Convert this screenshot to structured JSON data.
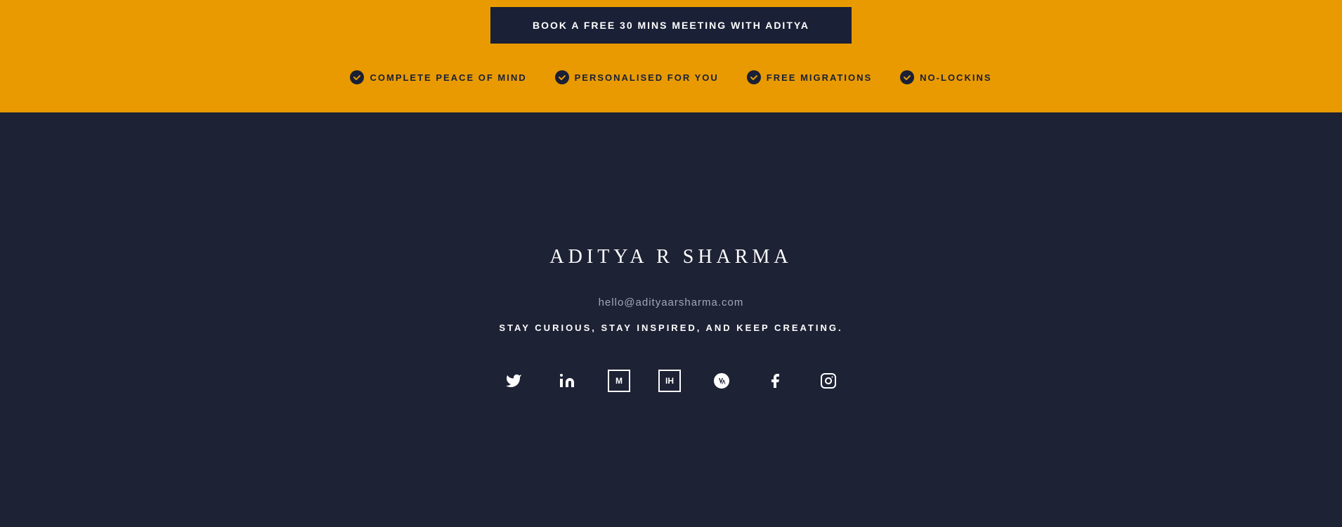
{
  "orange_section": {
    "cta_button_label": "BOOK A FREE 30 MINS MEETING WITH ADITYA",
    "features": [
      {
        "id": "peace",
        "text": "COMPLETE PEACE OF MIND"
      },
      {
        "id": "personalised",
        "text": "PERSONALISED FOR YOU"
      },
      {
        "id": "migrations",
        "text": "FREE MIGRATIONS"
      },
      {
        "id": "lockins",
        "text": "NO-LOCKINS"
      }
    ]
  },
  "dark_section": {
    "name": "ADITYA R SHARMA",
    "email": "hello@adityaarsharma.com",
    "tagline": "STAY CURIOUS, STAY INSPIRED, AND KEEP CREATING.",
    "social_links": [
      {
        "id": "twitter",
        "label": "Twitter"
      },
      {
        "id": "linkedin",
        "label": "LinkedIn"
      },
      {
        "id": "medium",
        "label": "Medium"
      },
      {
        "id": "indiehackers",
        "label": "Indie Hackers"
      },
      {
        "id": "wordpress",
        "label": "WordPress"
      },
      {
        "id": "facebook",
        "label": "Facebook"
      },
      {
        "id": "instagram",
        "label": "Instagram"
      }
    ]
  },
  "colors": {
    "orange": "#E89A00",
    "dark": "#1e2235",
    "dark_navy": "#1a2035",
    "white": "#ffffff",
    "muted": "#a0a8b8"
  }
}
